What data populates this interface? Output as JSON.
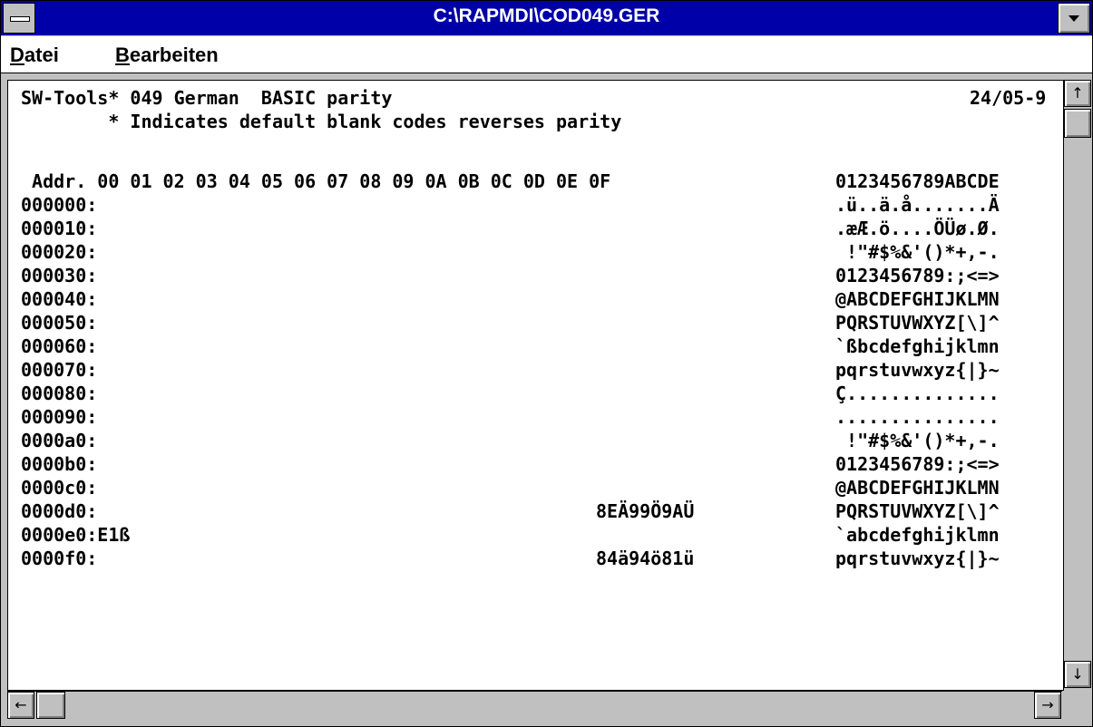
{
  "window": {
    "title": "C:\\RAPMDI\\COD049.GER"
  },
  "menubar": {
    "items": [
      {
        "accel": "D",
        "rest": "atei"
      },
      {
        "accel": "B",
        "rest": "earbeiten"
      }
    ]
  },
  "content": {
    "header_line1": "SW-Tools* 049 German  BASIC parity",
    "header_date": "24/05-9",
    "header_line2": "        * Indicates default blank codes reverses parity",
    "column_header": " Addr. 00 01 02 03 04 05 06 07 08 09 0A 0B 0C 0D 0E 0F",
    "ascii_header": "0123456789ABCDE",
    "rows": [
      {
        "addr": "000000:",
        "hex": "",
        "ascii": ".ü..ä.å.......Ä"
      },
      {
        "addr": "000010:",
        "hex": "",
        "ascii": ".æÆ.ö....ÖÜø.Ø."
      },
      {
        "addr": "000020:",
        "hex": "",
        "ascii": " !\"#$%&'()*+,-."
      },
      {
        "addr": "000030:",
        "hex": "",
        "ascii": "0123456789:;<=>"
      },
      {
        "addr": "000040:",
        "hex": "",
        "ascii": "@ABCDEFGHIJKLMN"
      },
      {
        "addr": "000050:",
        "hex": "",
        "ascii": "PQRSTUVWXYZ[\\]^"
      },
      {
        "addr": "000060:",
        "hex": "",
        "ascii": "`ßbcdefghijklmn"
      },
      {
        "addr": "000070:",
        "hex": "",
        "ascii": "pqrstuvwxyz{|}~"
      },
      {
        "addr": "000080:",
        "hex": "",
        "ascii": "Ç.............."
      },
      {
        "addr": "000090:",
        "hex": "",
        "ascii": "..............."
      },
      {
        "addr": "0000a0:",
        "hex": "",
        "ascii": " !\"#$%&'()*+,-."
      },
      {
        "addr": "0000b0:",
        "hex": "",
        "ascii": "0123456789:;<=>"
      },
      {
        "addr": "0000c0:",
        "hex": "",
        "ascii": "@ABCDEFGHIJKLMN"
      },
      {
        "addr": "0000d0:",
        "hex": "8EÄ99Ö9AÜ",
        "ascii": "PQRSTUVWXYZ[\\]^"
      },
      {
        "addr": "0000e0:E1ß",
        "hex": "",
        "ascii": "`abcdefghijklmn"
      },
      {
        "addr": "0000f0:",
        "hex": "84ä94ö81ü",
        "ascii": "pqrstuvwxyz{|}~"
      }
    ]
  },
  "scrollbars": {
    "up": "↑",
    "down": "↓",
    "left": "←",
    "right": "→"
  }
}
